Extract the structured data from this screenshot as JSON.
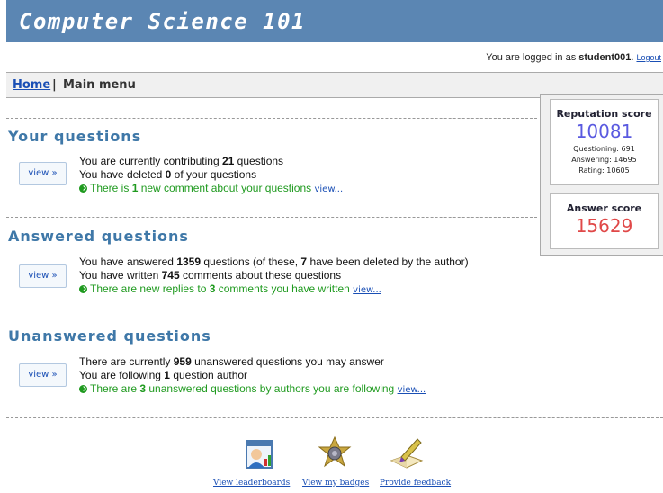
{
  "header": {
    "title": "Computer Science 101"
  },
  "login": {
    "prefix": "You are logged in as",
    "username": "student001",
    "suffix": ".",
    "logout_label": "Logout"
  },
  "nav": {
    "home_label": "Home",
    "separator": "|",
    "current_label": "Main menu"
  },
  "sections": [
    {
      "title": "Your questions",
      "button_label": "view »",
      "lines": [
        {
          "before": "You are currently contributing ",
          "value": "21",
          "after": " questions"
        },
        {
          "before": "You have deleted ",
          "value": "0",
          "after": " of your questions"
        }
      ],
      "notice": {
        "before": "There is ",
        "value": "1",
        "after": " new comment about your questions ",
        "link": "view..."
      }
    },
    {
      "title": "Answered questions",
      "button_label": "view »",
      "lines": [
        {
          "before": "You have answered ",
          "value": "1359",
          "mid": " questions (of these, ",
          "value2": "7",
          "after": " have been deleted by the author)"
        },
        {
          "before": "You have written ",
          "value": "745",
          "after": " comments about these questions"
        }
      ],
      "notice": {
        "before": "There are new replies to ",
        "value": "3",
        "after": " comments you have written ",
        "link": "view..."
      }
    },
    {
      "title": "Unanswered questions",
      "button_label": "view »",
      "lines": [
        {
          "before": "There are currently ",
          "value": "959",
          "after": " unanswered questions you may answer"
        },
        {
          "before": "You are following ",
          "value": "1",
          "after": " question author"
        }
      ],
      "notice": {
        "before": "There are ",
        "value": "3",
        "after": " unanswered questions by authors you are following ",
        "link": "view..."
      }
    }
  ],
  "scores": {
    "reputation": {
      "title": "Reputation score",
      "value": "10081",
      "questioning": "Questioning: 691",
      "answering": "Answering: 14695",
      "rating": "Rating: 10605"
    },
    "answer": {
      "title": "Answer score",
      "value": "15629"
    }
  },
  "footer": {
    "leaderboards_label": "View leaderboards",
    "badges_label": "View my badges",
    "feedback_label": "Provide feedback"
  },
  "colors": {
    "banner": "#5b86b3",
    "section_title": "#3f78a8",
    "notice_green": "#1f9a1f",
    "reputation_blue": "#5a5ae0",
    "answer_red": "#e04848",
    "link": "#1a4fb5"
  }
}
